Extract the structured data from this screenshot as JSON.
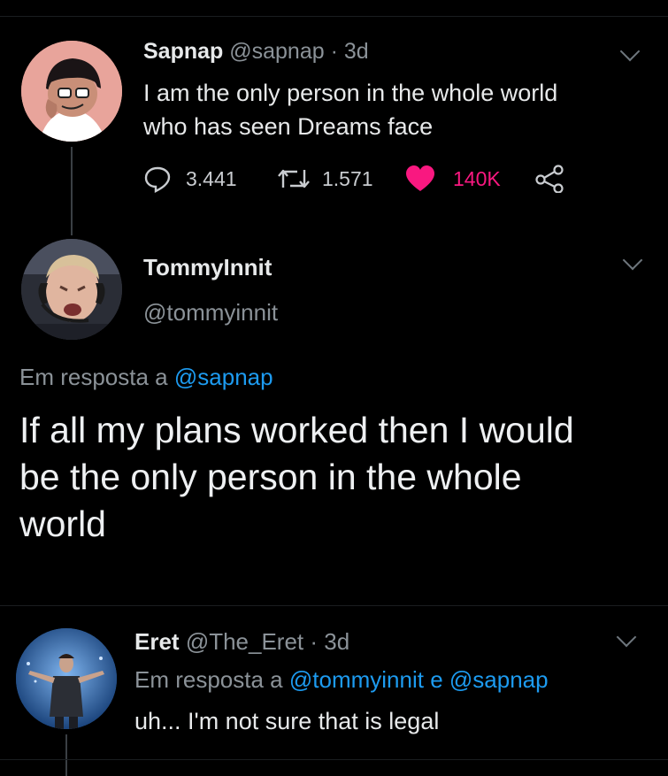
{
  "tweet1": {
    "display_name": "Sapnap",
    "handle": "@sapnap",
    "time": "· 3d",
    "text_line1": "I am the only person in the whole world",
    "text_line2": "who has seen Dreams face",
    "replies": "3.441",
    "retweets": "1.571",
    "likes": "140K",
    "like_color": "#f91880"
  },
  "tweet2": {
    "display_name": "TommyInnit",
    "handle": "@tommyinnit",
    "reply_prefix": "Em resposta a",
    "reply_to": "@sapnap",
    "text_line1": "If all my plans worked then I would",
    "text_line2": "be the only person in the whole",
    "text_line3": "world"
  },
  "tweet3": {
    "display_name": "Eret",
    "handle": "@The_Eret",
    "time": "· 3d",
    "reply_prefix": "Em resposta a",
    "reply_to_1": "@tommyinnit",
    "reply_joiner": "e",
    "reply_to_2": "@sapnap",
    "text": "uh... I'm not sure that is legal"
  },
  "colors": {
    "background": "#000000",
    "link": "#1d9bf0",
    "text": "#e7e9ea",
    "muted": "#8b9298"
  },
  "icons": [
    "reply-icon",
    "retweet-icon",
    "heart-icon",
    "share-icon",
    "chevron-down-icon"
  ]
}
